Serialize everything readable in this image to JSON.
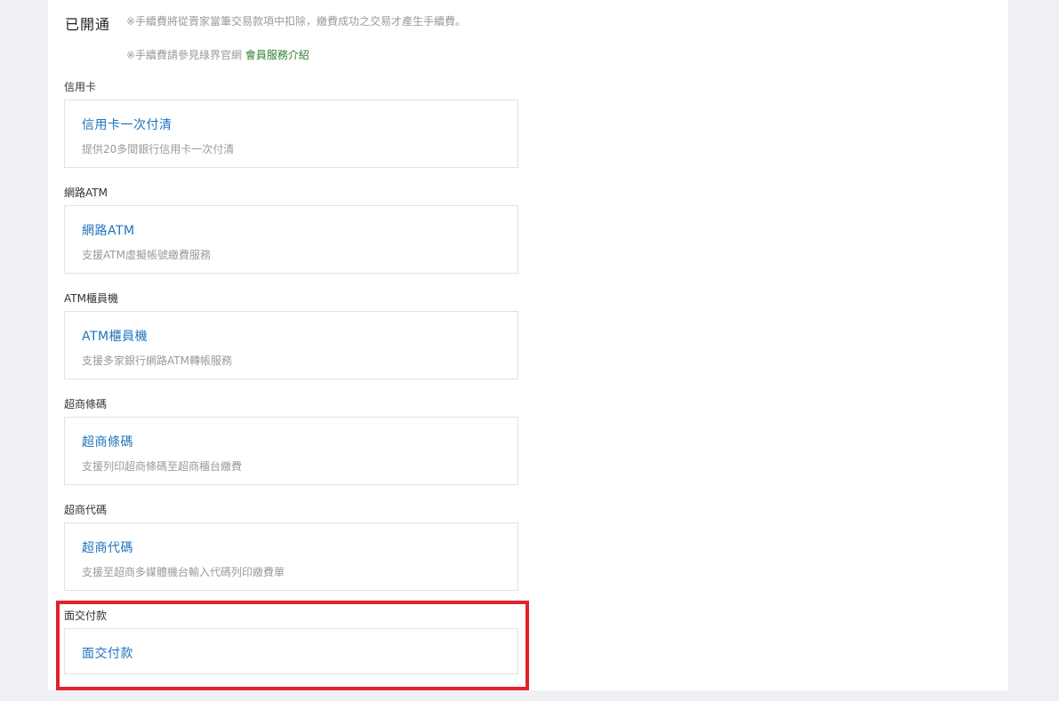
{
  "status": {
    "title": "已開通"
  },
  "notes": {
    "fee_note": "※手續費將從賣家當筆交易款項中扣除，繳費成功之交易才產生手續費。",
    "ref_note": "※手續費請參見綠界官網",
    "ref_link": "會員服務介紹"
  },
  "sections": [
    {
      "label": "信用卡",
      "title": "信用卡一次付清",
      "desc": "提供20多間銀行信用卡一次付清"
    },
    {
      "label": "網路ATM",
      "title": "網路ATM",
      "desc": "支援ATM虛擬帳號繳費服務"
    },
    {
      "label": "ATM櫃員機",
      "title": "ATM櫃員機",
      "desc": "支援多家銀行網路ATM轉帳服務"
    },
    {
      "label": "超商條碼",
      "title": "超商條碼",
      "desc": "支援列印超商條碼至超商櫃台繳費"
    },
    {
      "label": "超商代碼",
      "title": "超商代碼",
      "desc": "支援至超商多媒體機台輸入代碼列印繳費單"
    },
    {
      "label": "面交付款",
      "title": "面交付款",
      "desc": ""
    }
  ],
  "colors": {
    "background": "#eff0f4",
    "panel": "#ffffff",
    "card_title": "#1e73be",
    "link": "#2e7d32",
    "highlight": "#e2232a"
  }
}
